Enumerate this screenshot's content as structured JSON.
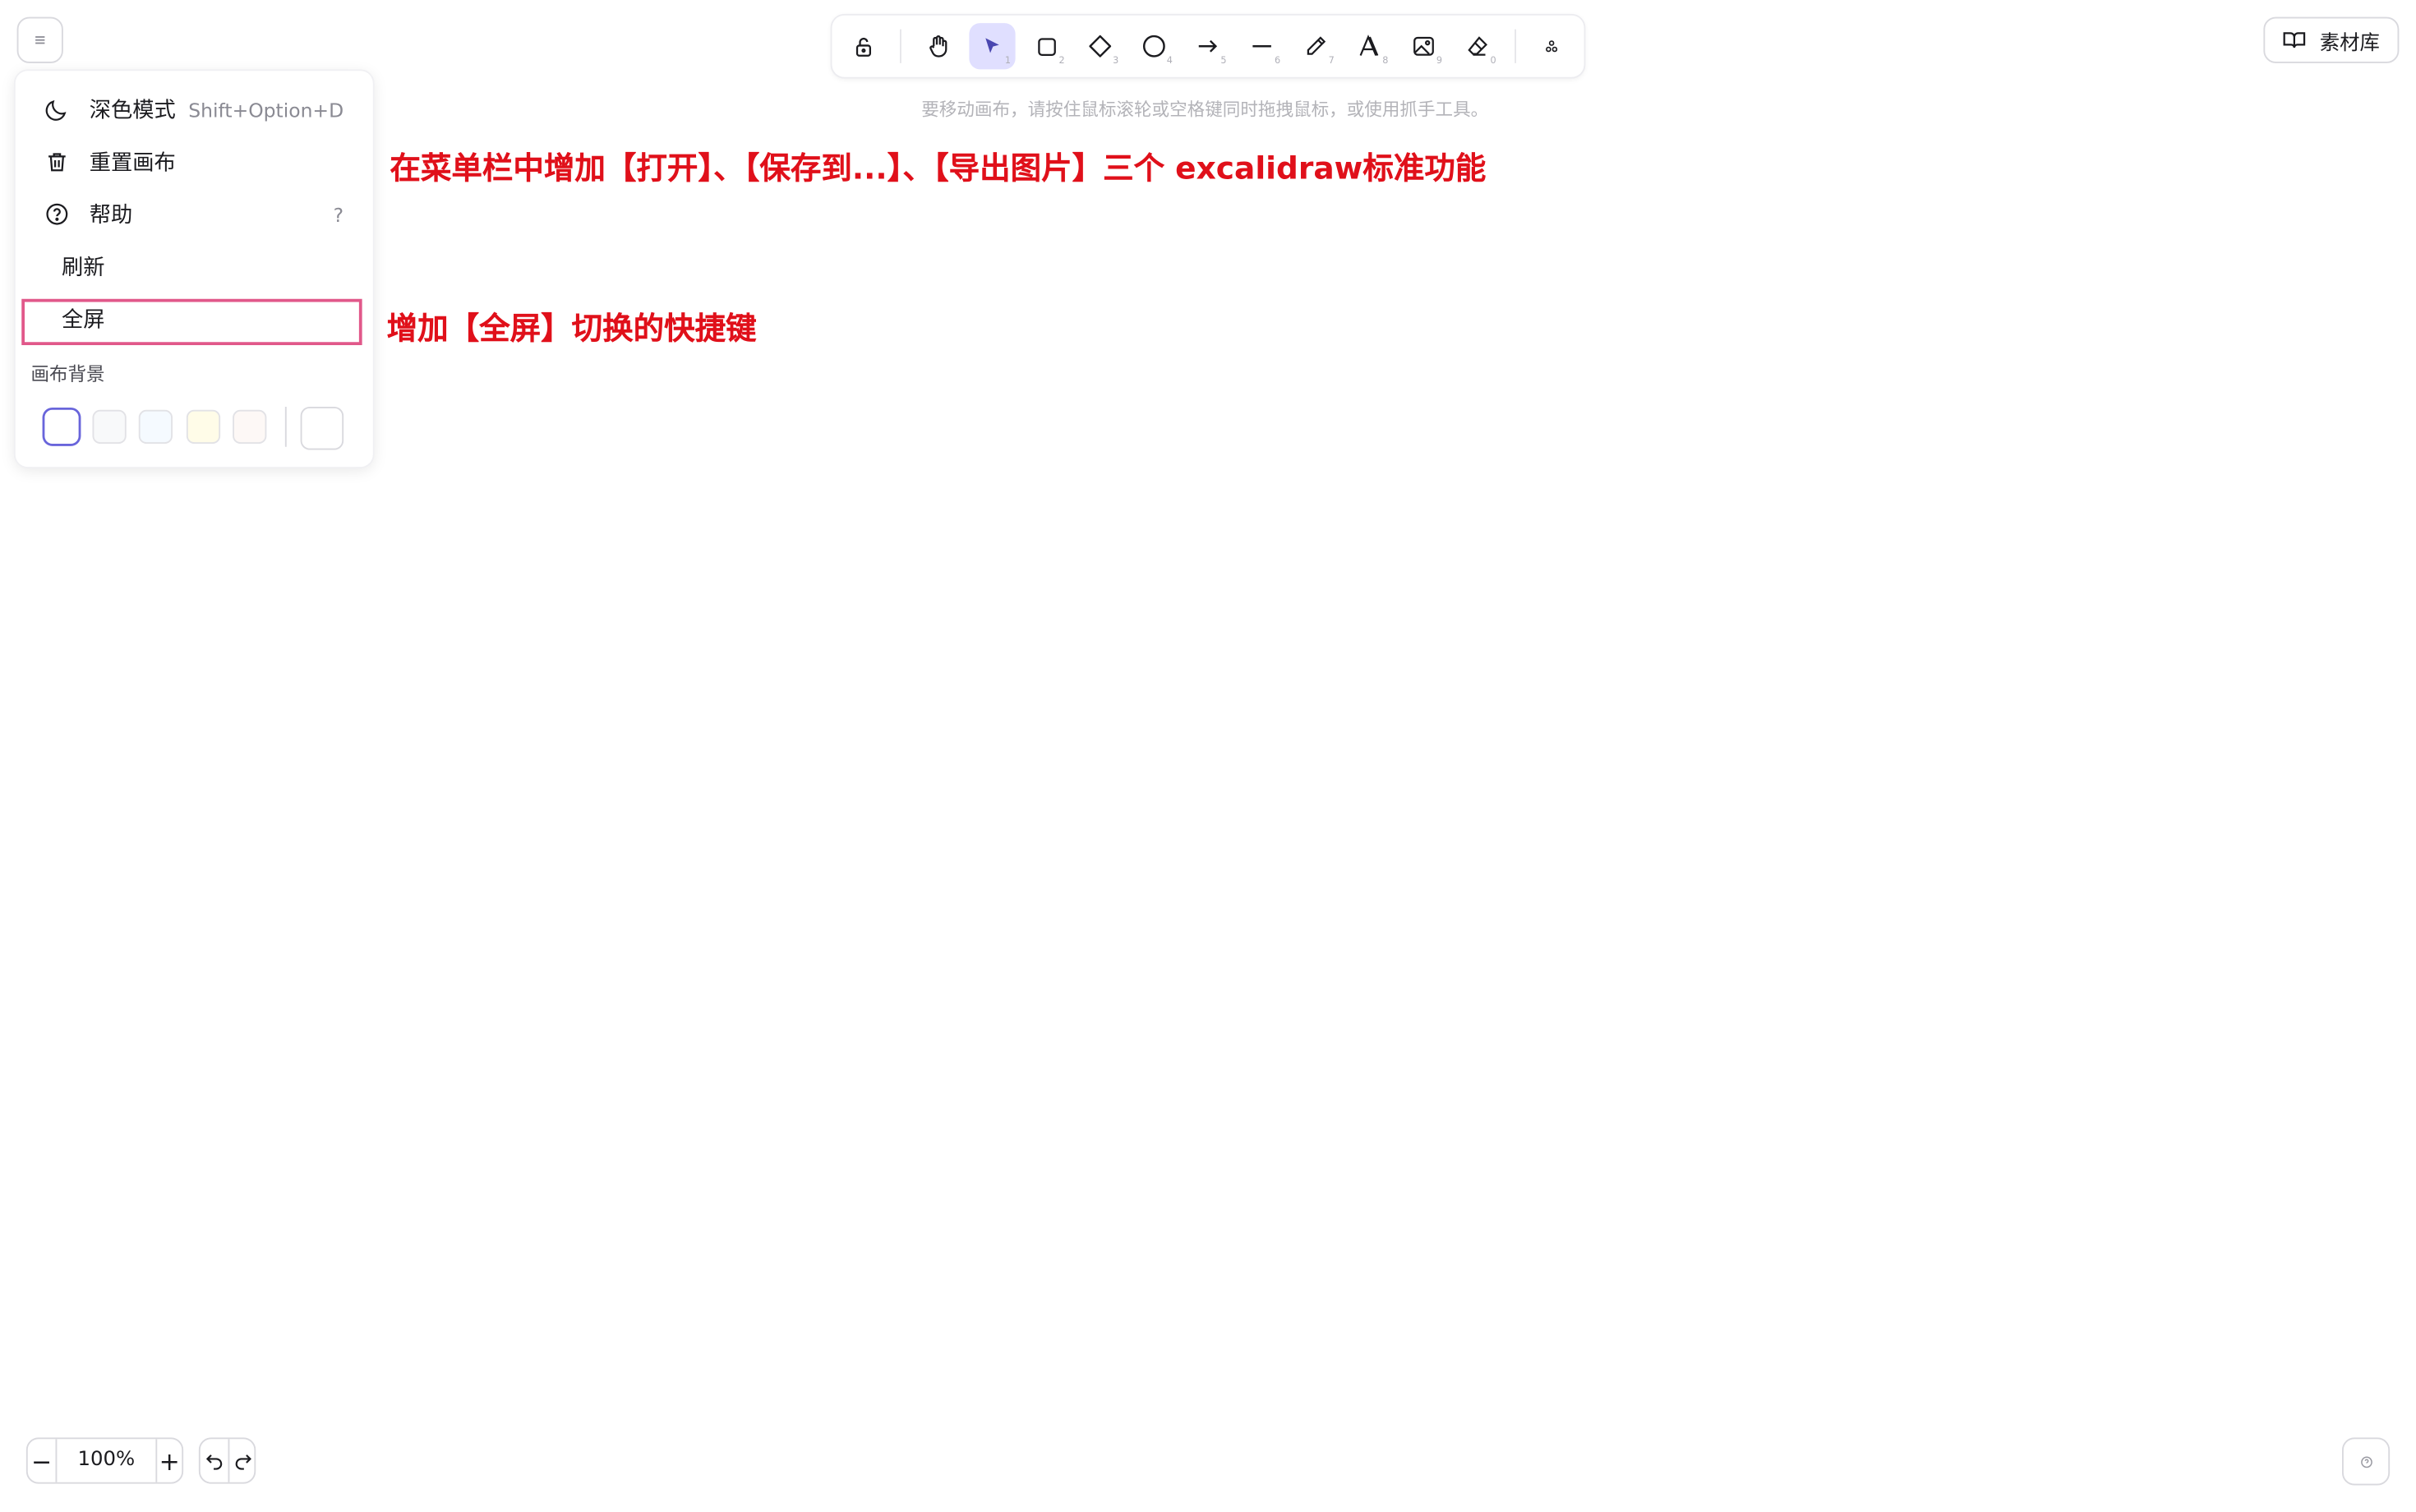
{
  "toolbar": {
    "tools": [
      {
        "name": "lock",
        "key": ""
      },
      {
        "name": "hand",
        "key": ""
      },
      {
        "name": "selection",
        "key": "1",
        "active": true
      },
      {
        "name": "rectangle",
        "key": "2"
      },
      {
        "name": "diamond",
        "key": "3"
      },
      {
        "name": "ellipse",
        "key": "4"
      },
      {
        "name": "arrow",
        "key": "5"
      },
      {
        "name": "line",
        "key": "6"
      },
      {
        "name": "draw",
        "key": "7"
      },
      {
        "name": "text",
        "key": "8"
      },
      {
        "name": "image",
        "key": "9"
      },
      {
        "name": "eraser",
        "key": "0"
      },
      {
        "name": "more-tools",
        "key": ""
      }
    ],
    "hint": "要移动画布，请按住鼠标滚轮或空格键同时拖拽鼠标，或使用抓手工具。"
  },
  "library": {
    "label": "素材库"
  },
  "menu": {
    "items": [
      {
        "icon": "moon-icon",
        "label": "深色模式",
        "shortcut": "Shift+Option+D"
      },
      {
        "icon": "trash-icon",
        "label": "重置画布",
        "shortcut": ""
      },
      {
        "icon": "help-circle-icon",
        "label": "帮助",
        "shortcut": "?"
      },
      {
        "icon": "",
        "label": "刷新",
        "shortcut": ""
      },
      {
        "icon": "",
        "label": "全屏",
        "shortcut": ""
      }
    ],
    "canvas_bg_title": "画布背景",
    "bg_swatches": [
      "#ffffff",
      "#f8f9fa",
      "#f5faff",
      "#fffce8",
      "#fdf8f6"
    ],
    "bg_selected": "#ffffff"
  },
  "annotations": {
    "menu_note": "在菜单栏中增加【打开】、【保存到...】、【导出图片】三个 excalidraw标准功能",
    "fullscreen_note": "增加【全屏】切换的快捷键",
    "color": "#e0101a",
    "highlight_color": "#e1588a"
  },
  "zoom": {
    "minus": "−",
    "value": "100%",
    "plus": "+"
  },
  "accent": "#6965db"
}
